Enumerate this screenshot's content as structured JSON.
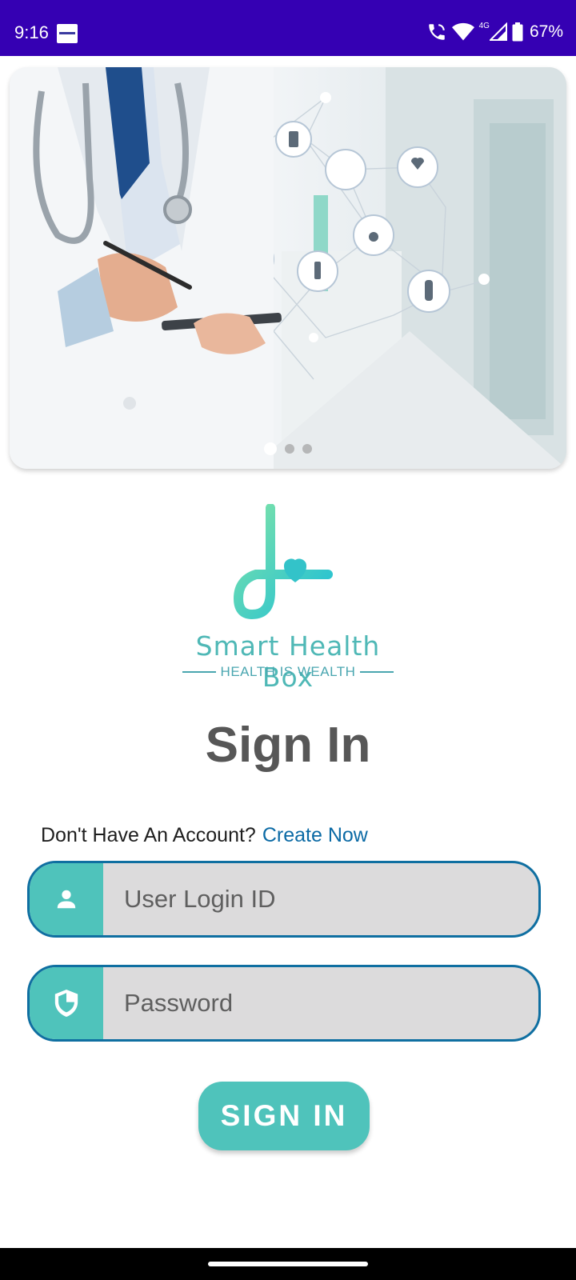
{
  "status_bar": {
    "time": "9:16",
    "network": "4G",
    "battery": "67%"
  },
  "banner": {
    "active_slide": 1,
    "slide_count": 3
  },
  "logo": {
    "name": "Smart Health Box",
    "tagline": "HEALTH IS WEALTH"
  },
  "page_title": "Sign In",
  "account": {
    "prompt": "Don't Have An Account?",
    "link": "Create Now"
  },
  "form": {
    "user_placeholder": "User Login ID",
    "password_placeholder": "Password",
    "submit_label": "SIGN IN"
  },
  "colors": {
    "status_bar": "#3500b3",
    "accent_teal": "#4fc3bb",
    "field_border": "#0f6fa1",
    "link": "#0b6aa5"
  }
}
